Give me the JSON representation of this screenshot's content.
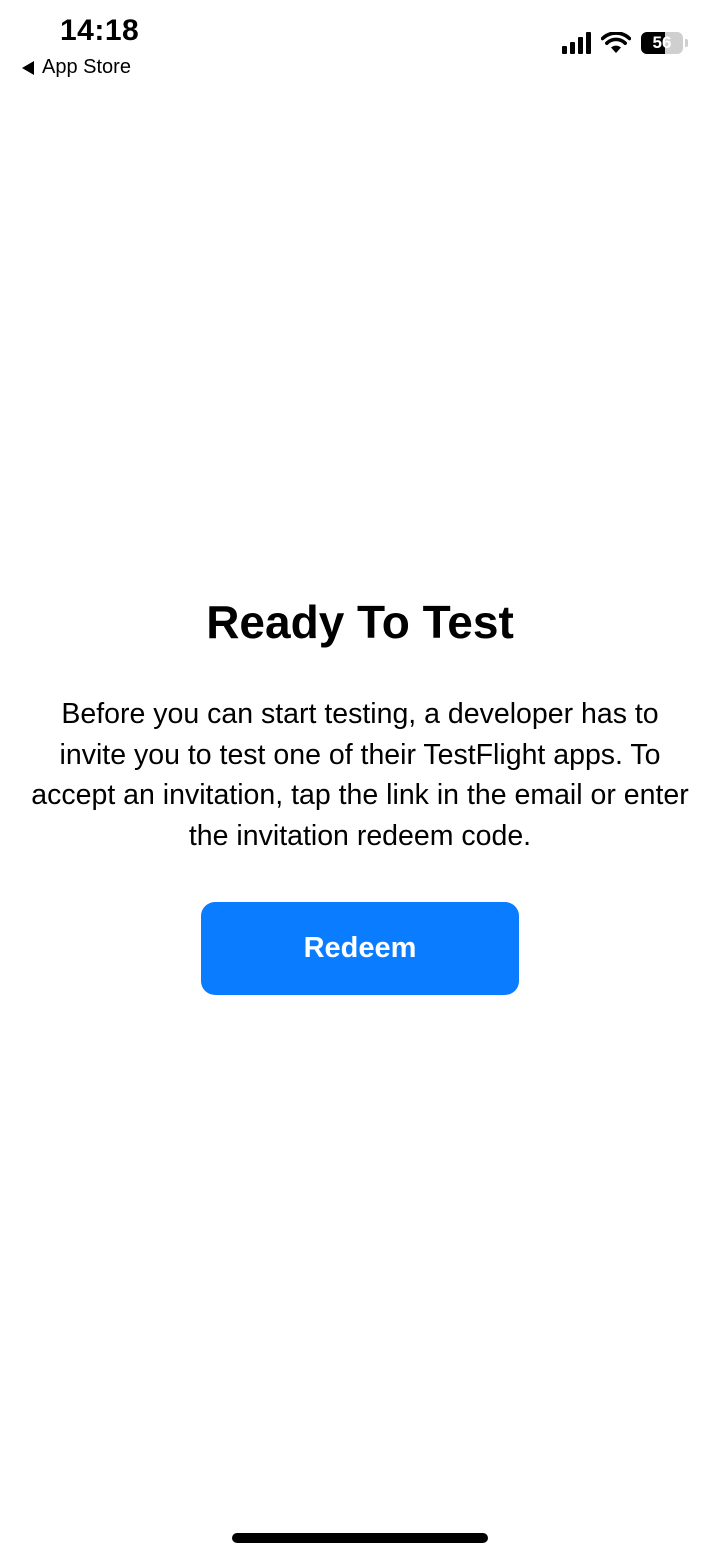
{
  "status_bar": {
    "time": "14:18",
    "back_label": "App Store",
    "battery": "56",
    "battery_level": 0.56,
    "icons": [
      "back-arrow-icon",
      "cellular-signal-icon",
      "wifi-icon",
      "battery-icon"
    ]
  },
  "main": {
    "title": "Ready To Test",
    "description": "Before you can start testing, a developer has to invite you to test one of their TestFlight apps. To accept an invitation, tap the link in the email or enter the invitation redeem code.",
    "redeem_label": "Redeem"
  },
  "colors": {
    "accent": "#0a7cff",
    "background": "#ffffff",
    "text": "#000000"
  }
}
